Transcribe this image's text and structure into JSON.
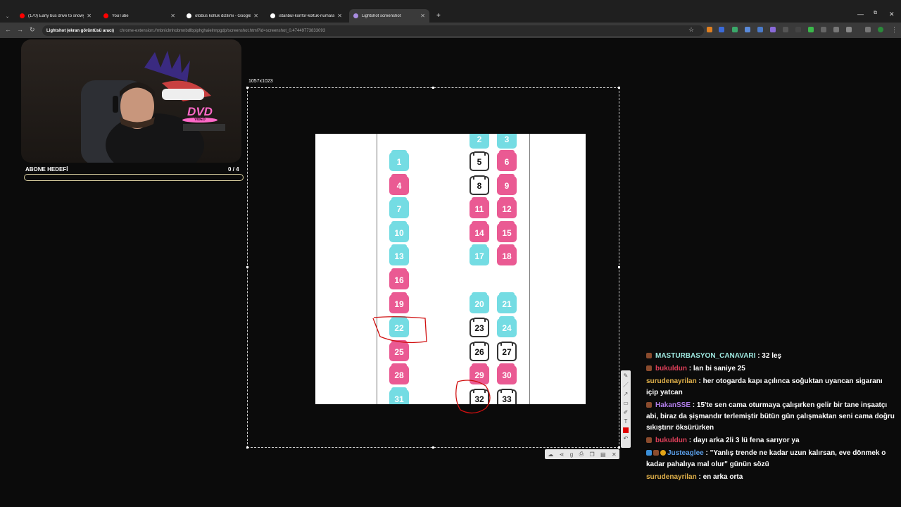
{
  "browser": {
    "tabs": [
      {
        "label": "(170) Early bus drive to snowy ·",
        "favicon_color": "#ff0000"
      },
      {
        "label": "YouTube",
        "favicon_color": "#ff0000"
      },
      {
        "label": "otobüs koltuk dizilimi - Google",
        "favicon_color": "#ffffff"
      },
      {
        "label": "istanbul-konfor-koltuk-numara",
        "favicon_color": "#ffffff"
      },
      {
        "label": "Lightshot screenshot",
        "favicon_color": "#a98de0"
      }
    ],
    "new_tab_icon": "+",
    "address_chip": "Lightshot (ekran görüntüsü aracı)",
    "url": "chrome-extension://mbniclmhobmnbdlbpiphghaielnnpgdp/screenshot.html?id=screenshot_0.47449773833093"
  },
  "stream": {
    "goal_label": "ABONE HEDEFİ",
    "goal_count": "0 / 4",
    "goal_progress": 0,
    "dvd_logo": "DVD",
    "dvd_sub": "VIDEO"
  },
  "lightshot": {
    "size_label": "1057x1023"
  },
  "seats": {
    "left": [
      {
        "n": "1",
        "color": "blue"
      },
      {
        "n": "4",
        "color": "pink"
      },
      {
        "n": "7",
        "color": "blue"
      },
      {
        "n": "10",
        "color": "blue"
      },
      {
        "n": "13",
        "color": "blue"
      },
      {
        "n": "16",
        "color": "pink"
      },
      {
        "n": "19",
        "color": "pink"
      },
      {
        "n": "22",
        "color": "blue"
      },
      {
        "n": "25",
        "color": "pink"
      },
      {
        "n": "28",
        "color": "pink"
      },
      {
        "n": "31",
        "color": "blue"
      }
    ],
    "mid": [
      {
        "n": "2",
        "color": "blue"
      },
      {
        "n": "5",
        "color": "white"
      },
      {
        "n": "8",
        "color": "white"
      },
      {
        "n": "11",
        "color": "pink"
      },
      {
        "n": "14",
        "color": "pink"
      },
      {
        "n": "17",
        "color": "blue"
      },
      {
        "n": "20",
        "color": "blue"
      },
      {
        "n": "23",
        "color": "white"
      },
      {
        "n": "26",
        "color": "white"
      },
      {
        "n": "29",
        "color": "pink"
      },
      {
        "n": "32",
        "color": "white"
      }
    ],
    "right": [
      {
        "n": "3",
        "color": "blue"
      },
      {
        "n": "6",
        "color": "pink"
      },
      {
        "n": "9",
        "color": "pink"
      },
      {
        "n": "12",
        "color": "pink"
      },
      {
        "n": "15",
        "color": "pink"
      },
      {
        "n": "18",
        "color": "pink"
      },
      {
        "n": "21",
        "color": "blue"
      },
      {
        "n": "24",
        "color": "blue"
      },
      {
        "n": "27",
        "color": "white"
      },
      {
        "n": "30",
        "color": "pink"
      },
      {
        "n": "33",
        "color": "white"
      }
    ]
  },
  "chat": [
    {
      "user": "MASTURBASYON_CANAVARI",
      "user_color": "#9ee8e0",
      "text": " : 32 leş",
      "badge": "brown"
    },
    {
      "user": "bukuldun",
      "user_color": "#e0405a",
      "text": " : lan bi saniye 25",
      "badge": "brown"
    },
    {
      "user": "surudenayrilan",
      "user_color": "#e0b04a",
      "text": " : her otogarda kapı açılınca soğuktan uyancan sigaranı içip yatcan",
      "badge": "none"
    },
    {
      "user": "HakanSSE",
      "user_color": "#b07de8",
      "text": " : 15'te sen cama oturmaya çalışırken gelir bir tane inşaatçı abi, biraz da şişmandır terlemiştir bütün gün çalışmaktan seni cama doğru sıkıştırır öksürürken",
      "badge": "brown"
    },
    {
      "user": "bukuldun",
      "user_color": "#e0405a",
      "text": " : dayı arka 2li 3 lü fena sarıyor ya",
      "badge": "brown"
    },
    {
      "user": "Justeaglee",
      "user_color": "#5a9ee8",
      "text": " : \"Yanlış trende ne kadar uzun kalırsan, eve dönmek o kadar pahalıya mal olur\" günün sözü",
      "badge": "multi"
    },
    {
      "user": "surudenayrilan",
      "user_color": "#e0b04a",
      "text": " : en arka orta",
      "badge": "none"
    }
  ]
}
